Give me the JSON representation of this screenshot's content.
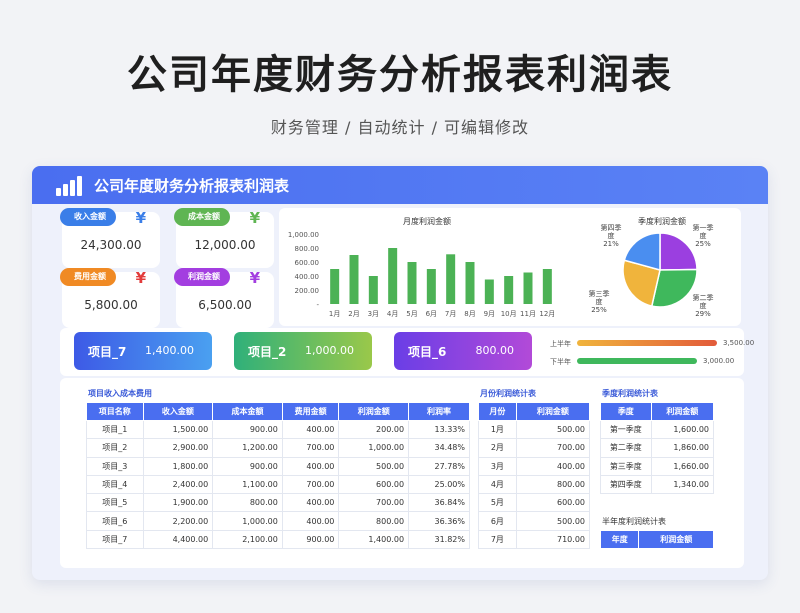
{
  "header": {
    "title": "公司年度财务分析报表利润表",
    "subtitle": "财务管理 / 自动统计 /  可编辑修改"
  },
  "card": {
    "title": "公司年度财务分析报表利润表"
  },
  "kpis": [
    {
      "label": "收入金额",
      "value": "24,300.00",
      "yen": "¥"
    },
    {
      "label": "成本金额",
      "value": "12,000.00",
      "yen": "¥"
    },
    {
      "label": "费用金额",
      "value": "5,800.00",
      "yen": "¥"
    },
    {
      "label": "利润金额",
      "value": "6,500.00",
      "yen": "¥"
    }
  ],
  "colors": {
    "accent": "#4a6ef0",
    "kpi_pills": [
      "#3a7ee8",
      "#5fb553",
      "#f08a24",
      "#a33ee0"
    ],
    "kpi_yen": [
      "#3a7ee8",
      "#5fb553",
      "#e23b3b",
      "#a33ee0"
    ]
  },
  "chart_data": [
    {
      "type": "bar",
      "title": "月度利润金额",
      "categories": [
        "1月",
        "2月",
        "3月",
        "4月",
        "5月",
        "6月",
        "7月",
        "8月",
        "9月",
        "10月",
        "11月",
        "12月"
      ],
      "values": [
        500,
        700,
        400,
        800,
        600,
        500,
        710,
        600,
        350,
        400,
        450,
        500
      ],
      "ylim": [
        0,
        1000
      ],
      "yticks": [
        "1,000.00",
        "800.00",
        "600.00",
        "400.00",
        "200.00",
        "-"
      ],
      "color": "#4cb255"
    },
    {
      "type": "pie",
      "title": "季度利润金额",
      "slices": [
        {
          "name": "第一季度",
          "label_lines": [
            "第一季",
            "度"
          ],
          "pct": "25%",
          "value": 1600,
          "color": "#9b3fe0"
        },
        {
          "name": "第二季度",
          "label_lines": [
            "第二季",
            "度"
          ],
          "pct": "29%",
          "value": 1860,
          "color": "#3fb85c"
        },
        {
          "name": "第三季度",
          "label_lines": [
            "第三季",
            "度"
          ],
          "pct": "25%",
          "value": 1660,
          "color": "#f0b43c"
        },
        {
          "name": "第四季度",
          "label_lines": [
            "第四季",
            "度"
          ],
          "pct": "21%",
          "value": 1340,
          "color": "#4a8ef0"
        }
      ]
    },
    {
      "type": "bar",
      "orientation": "horizontal",
      "categories": [
        "上半年",
        "下半年"
      ],
      "values": [
        3500,
        3000
      ],
      "value_labels": [
        "3,500.00",
        "3,000.00"
      ],
      "colors": [
        [
          "#f0b43c",
          "#e25a3a"
        ],
        [
          "#3fb85c",
          "#3fb85c"
        ]
      ]
    }
  ],
  "banners": [
    {
      "name": "项目_7",
      "value": "1,400.00"
    },
    {
      "name": "项目_2",
      "value": "1,000.00"
    },
    {
      "name": "项目_6",
      "value": "800.00"
    }
  ],
  "project_table": {
    "caption": "项目收入成本费用",
    "headers": [
      "项目名称",
      "收入金额",
      "成本金额",
      "费用金额",
      "利润金额",
      "利润率"
    ],
    "rows": [
      [
        "项目_1",
        "1,500.00",
        "900.00",
        "400.00",
        "200.00",
        "13.33%"
      ],
      [
        "项目_2",
        "2,900.00",
        "1,200.00",
        "700.00",
        "1,000.00",
        "34.48%"
      ],
      [
        "项目_3",
        "1,800.00",
        "900.00",
        "400.00",
        "500.00",
        "27.78%"
      ],
      [
        "项目_4",
        "2,400.00",
        "1,100.00",
        "700.00",
        "600.00",
        "25.00%"
      ],
      [
        "项目_5",
        "1,900.00",
        "800.00",
        "400.00",
        "700.00",
        "36.84%"
      ],
      [
        "项目_6",
        "2,200.00",
        "1,000.00",
        "400.00",
        "800.00",
        "36.36%"
      ],
      [
        "项目_7",
        "4,400.00",
        "2,100.00",
        "900.00",
        "1,400.00",
        "31.82%"
      ]
    ]
  },
  "monthly_table": {
    "caption": "月份利润统计表",
    "headers": [
      "月份",
      "利润金额"
    ],
    "rows": [
      [
        "1月",
        "500.00"
      ],
      [
        "2月",
        "700.00"
      ],
      [
        "3月",
        "400.00"
      ],
      [
        "4月",
        "800.00"
      ],
      [
        "5月",
        "600.00"
      ],
      [
        "6月",
        "500.00"
      ],
      [
        "7月",
        "710.00"
      ]
    ]
  },
  "quarter_table": {
    "caption": "季度利润统计表",
    "headers": [
      "季度",
      "利润金额"
    ],
    "rows": [
      [
        "第一季度",
        "1,600.00"
      ],
      [
        "第二季度",
        "1,860.00"
      ],
      [
        "第三季度",
        "1,660.00"
      ],
      [
        "第四季度",
        "1,340.00"
      ]
    ]
  },
  "half_table": {
    "caption": "半年度利润统计表",
    "headers": [
      "年度",
      "利润金额"
    ]
  }
}
